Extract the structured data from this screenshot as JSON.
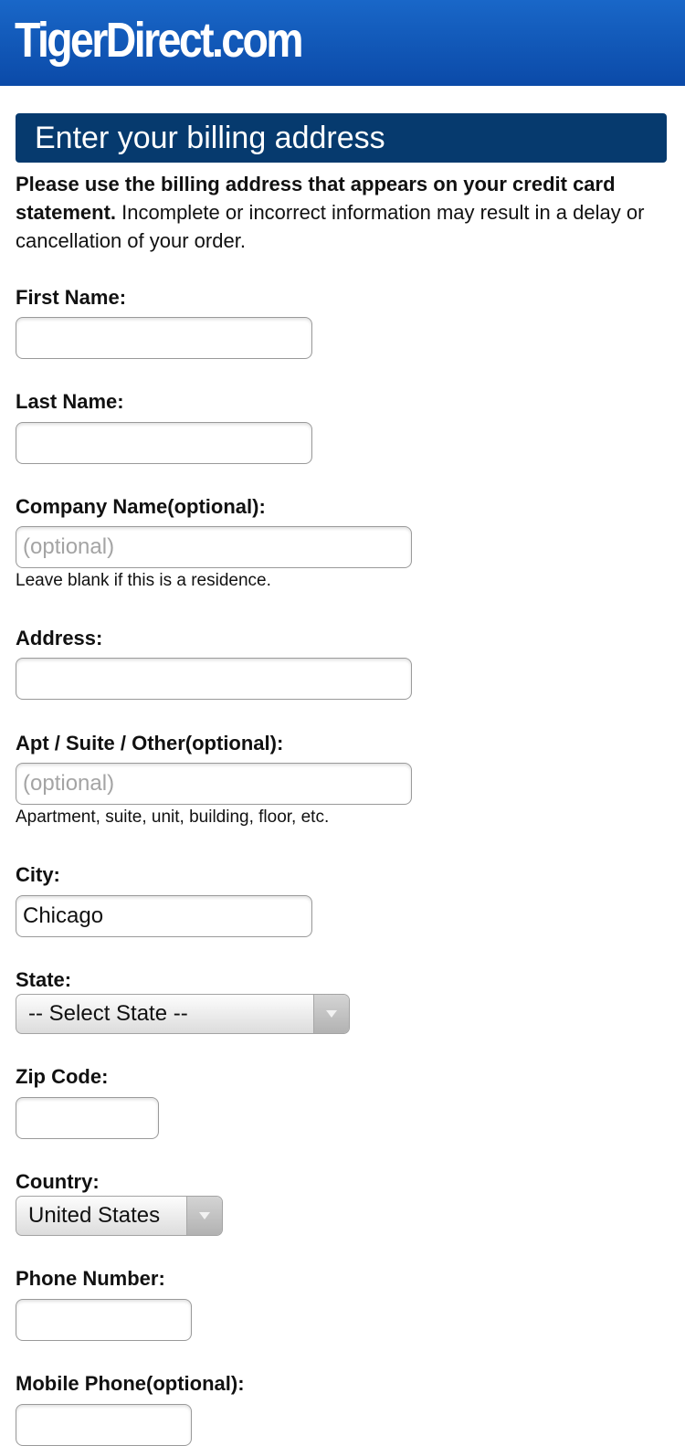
{
  "header": {
    "logo_text": "TigerDirect.com",
    "logo_mark": "."
  },
  "section": {
    "title": "Enter your billing address"
  },
  "intro": {
    "bold": "Please use the billing address that appears on your credit card statement.",
    "rest": " Incomplete or incorrect information may result in a delay or cancellation of your order."
  },
  "form": {
    "first_name": {
      "label": "First Name:",
      "value": ""
    },
    "last_name": {
      "label": "Last Name:",
      "value": ""
    },
    "company": {
      "label": "Company Name(optional):",
      "placeholder": "(optional)",
      "hint": "Leave blank if this is a residence."
    },
    "address": {
      "label": "Address:",
      "value": ""
    },
    "apt": {
      "label": "Apt / Suite / Other(optional):",
      "placeholder": "(optional)",
      "hint": "Apartment, suite, unit, building, floor, etc."
    },
    "city": {
      "label": "City:",
      "value": "Chicago"
    },
    "state": {
      "label": "State:",
      "selected": "-- Select State --"
    },
    "zip": {
      "label": "Zip Code:",
      "value": ""
    },
    "country": {
      "label": "Country:",
      "selected": "United States"
    },
    "phone": {
      "label": "Phone Number:",
      "value": ""
    },
    "mobile": {
      "label": "Mobile Phone(optional):",
      "value": ""
    }
  },
  "icons": {
    "dropdown": "chevron-down-icon"
  },
  "colors": {
    "topbar": "#0b4aa8",
    "section_header": "#063a6e",
    "placeholder": "#a4a4a4"
  }
}
